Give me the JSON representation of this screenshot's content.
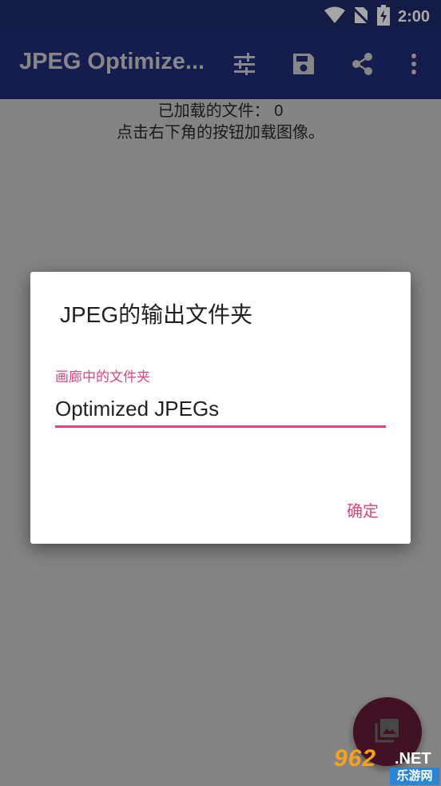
{
  "status_bar": {
    "time": "2:00",
    "icons": [
      "wifi-icon",
      "no-sim-icon",
      "battery-charging-icon"
    ]
  },
  "app_bar": {
    "title": "JPEG Optimize...",
    "actions": [
      "tune-icon",
      "save-icon",
      "share-icon",
      "more-vert-icon"
    ]
  },
  "main": {
    "files_loaded": "已加载的文件： 0",
    "hint": "点击右下角的按钮加载图像。"
  },
  "dialog": {
    "title": "JPEG的输出文件夹",
    "field_label": "画廊中的文件夹",
    "field_value": "Optimized JPEGs",
    "ok_label": "确定"
  },
  "fab": {
    "icon": "gallery-icon"
  },
  "watermark": {
    "top": "962",
    "net": ".NET",
    "bottom": "乐游网"
  },
  "colors": {
    "primary": "#283593",
    "status": "#1f2a6b",
    "accent": "#e4417d"
  }
}
